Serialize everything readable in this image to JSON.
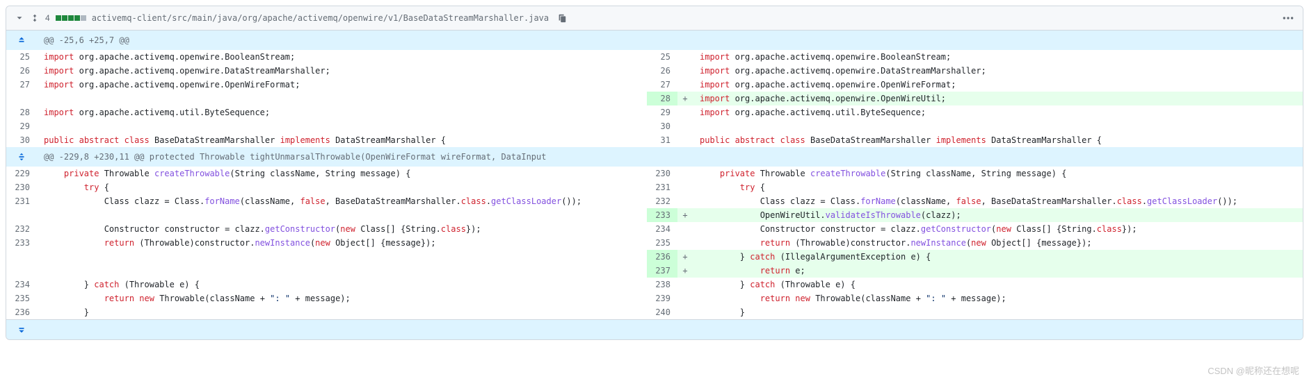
{
  "header": {
    "change_count": "4",
    "file_path": "activemq-client/src/main/java/org/apache/activemq/openwire/v1/BaseDataStreamMarshaller.java"
  },
  "hunks": {
    "h1": "@@ -25,6 +25,7 @@",
    "h2": "@@ -229,8 +230,11 @@ protected Throwable tightUnmarsalThrowable(OpenWireFormat wireFormat, DataInput"
  },
  "left": {
    "l25": {
      "num": "25",
      "t1": "import",
      "t2": " org.apache.activemq.openwire.BooleanStream;"
    },
    "l26": {
      "num": "26",
      "t1": "import",
      "t2": " org.apache.activemq.openwire.DataStreamMarshaller;"
    },
    "l27": {
      "num": "27",
      "t1": "import",
      "t2": " org.apache.activemq.openwire.OpenWireFormat;"
    },
    "l28": {
      "num": "28",
      "t1": "import",
      "t2": " org.apache.activemq.util.ByteSequence;"
    },
    "l29": {
      "num": "29"
    },
    "l30": {
      "num": "30",
      "a": "public",
      "b": "abstract",
      "c": "class",
      "d": " BaseDataStreamMarshaller ",
      "e": "implements",
      "f": " DataStreamMarshaller {"
    },
    "l229": {
      "num": "229",
      "pad": "    ",
      "a": "private",
      "b": " Throwable ",
      "fn": "createThrowable",
      "c": "(String className, String message) {"
    },
    "l230": {
      "num": "230",
      "pad": "        ",
      "a": "try",
      "b": " {"
    },
    "l231": {
      "num": "231",
      "pad": "            ",
      "a": "Class clazz = Class.",
      "fn": "forName",
      "b": "(className, ",
      "c": "false",
      "d": ", BaseDataStreamMarshaller.",
      "e": "class",
      "f": ".",
      "fn2": "getClassLoader",
      "g": "());"
    },
    "l232": {
      "num": "232",
      "pad": "            ",
      "a": "Constructor constructor = clazz.",
      "fn": "getConstructor",
      "b": "(",
      "c": "new",
      "d": " Class[] {String.",
      "e": "class",
      "f": "});"
    },
    "l233": {
      "num": "233",
      "pad": "            ",
      "a": "return",
      "b": " (Throwable)constructor.",
      "fn": "newInstance",
      "c": "(",
      "d": "new",
      "e": " Object[] {message});"
    },
    "l234": {
      "num": "234",
      "pad": "        ",
      "a": "} ",
      "b": "catch",
      "c": " (Throwable e) {"
    },
    "l235": {
      "num": "235",
      "pad": "            ",
      "a": "return",
      "b": " ",
      "c": "new",
      "d": " Throwable(className + ",
      "s": "\": \"",
      "e": " + message);"
    },
    "l236": {
      "num": "236",
      "pad": "        ",
      "a": "}"
    }
  },
  "right": {
    "r25": {
      "num": "25",
      "t1": "import",
      "t2": " org.apache.activemq.openwire.BooleanStream;"
    },
    "r26": {
      "num": "26",
      "t1": "import",
      "t2": " org.apache.activemq.openwire.DataStreamMarshaller;"
    },
    "r27": {
      "num": "27",
      "t1": "import",
      "t2": " org.apache.activemq.openwire.OpenWireFormat;"
    },
    "r28": {
      "num": "28",
      "t1": "import",
      "t2": " org.apache.activemq.openwire.OpenWireUtil;",
      "addition": true
    },
    "r29": {
      "num": "29",
      "t1": "import",
      "t2": " org.apache.activemq.util.ByteSequence;"
    },
    "r30": {
      "num": "30"
    },
    "r31": {
      "num": "31",
      "a": "public",
      "b": "abstract",
      "c": "class",
      "d": " BaseDataStreamMarshaller ",
      "e": "implements",
      "f": " DataStreamMarshaller {"
    },
    "r230": {
      "num": "230",
      "pad": "    ",
      "a": "private",
      "b": " Throwable ",
      "fn": "createThrowable",
      "c": "(String className, String message) {"
    },
    "r231": {
      "num": "231",
      "pad": "        ",
      "a": "try",
      "b": " {"
    },
    "r232": {
      "num": "232",
      "pad": "            ",
      "a": "Class clazz = Class.",
      "fn": "forName",
      "b": "(className, ",
      "c": "false",
      "d": ", BaseDataStreamMarshaller.",
      "e": "class",
      "f": ".",
      "fn2": "getClassLoader",
      "g": "());"
    },
    "r233": {
      "num": "233",
      "pad": "            ",
      "a": "OpenWireUtil.",
      "fn": "validateIsThrowable",
      "b": "(clazz);",
      "addition": true,
      "arrow": true
    },
    "r234": {
      "num": "234",
      "pad": "            ",
      "a": "Constructor constructor = clazz.",
      "fn": "getConstructor",
      "b": "(",
      "c": "new",
      "d": " Class[] {String.",
      "e": "class",
      "f": "});"
    },
    "r235": {
      "num": "235",
      "pad": "            ",
      "a": "return",
      "b": " (Throwable)constructor.",
      "fn": "newInstance",
      "c": "(",
      "d": "new",
      "e": " Object[] {message});"
    },
    "r236": {
      "num": "236",
      "pad": "        ",
      "a": "} ",
      "b": "catch",
      "c": " (IllegalArgumentException e) {",
      "addition": true,
      "arrow": true
    },
    "r237": {
      "num": "237",
      "pad": "            ",
      "a": "return",
      "b": " e;",
      "addition": true
    },
    "r238": {
      "num": "238",
      "pad": "        ",
      "a": "} ",
      "b": "catch",
      "c": " (Throwable e) {"
    },
    "r239": {
      "num": "239",
      "pad": "            ",
      "a": "return",
      "b": " ",
      "c": "new",
      "d": " Throwable(className + ",
      "s": "\": \"",
      "e": " + message);"
    },
    "r240": {
      "num": "240",
      "pad": "        ",
      "a": "}"
    }
  },
  "marks": {
    "plus": "+"
  },
  "watermark": "CSDN @昵称还在想呢"
}
